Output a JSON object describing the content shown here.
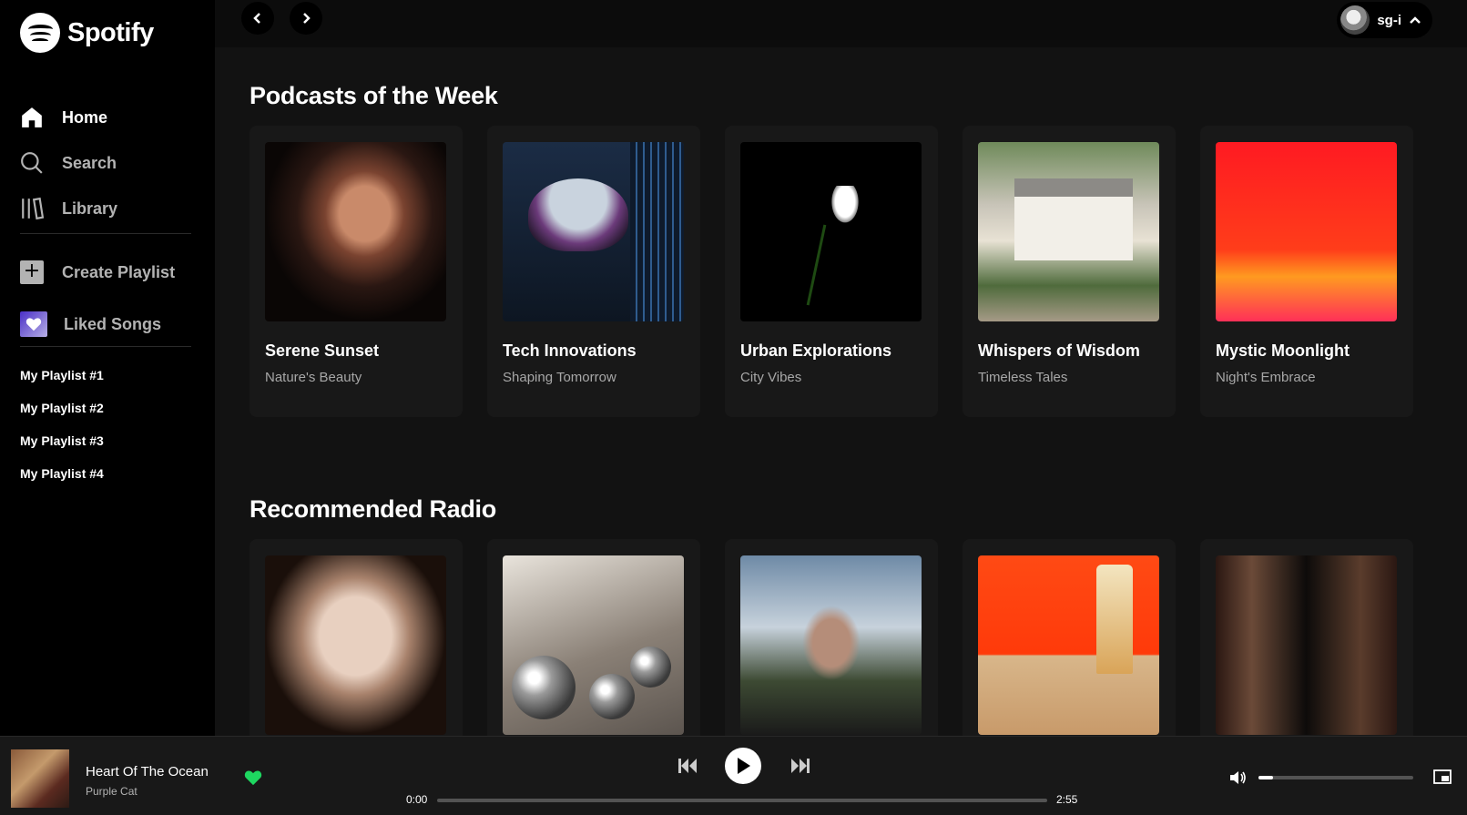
{
  "app": {
    "name": "Spotify"
  },
  "sidebar": {
    "nav": [
      {
        "label": "Home",
        "icon": "home-icon",
        "active": true
      },
      {
        "label": "Search",
        "icon": "search-icon",
        "active": false
      },
      {
        "label": "Library",
        "icon": "library-icon",
        "active": false
      }
    ],
    "create_playlist": "Create Playlist",
    "liked_songs": "Liked Songs",
    "playlists": [
      "My Playlist #1",
      "My Playlist #2",
      "My Playlist #3",
      "My Playlist #4"
    ]
  },
  "header": {
    "username": "sg-i"
  },
  "sections": [
    {
      "title": "Podcasts of the Week",
      "cards": [
        {
          "title": "Serene Sunset",
          "subtitle": "Nature's Beauty"
        },
        {
          "title": "Tech Innovations",
          "subtitle": "Shaping Tomorrow"
        },
        {
          "title": "Urban Explorations",
          "subtitle": "City Vibes"
        },
        {
          "title": "Whispers of Wisdom",
          "subtitle": "Timeless Tales"
        },
        {
          "title": "Mystic Moonlight",
          "subtitle": "Night's Embrace"
        }
      ]
    },
    {
      "title": "Recommended Radio",
      "cards": [
        {
          "title": "",
          "subtitle": ""
        },
        {
          "title": "",
          "subtitle": ""
        },
        {
          "title": "",
          "subtitle": ""
        },
        {
          "title": "",
          "subtitle": ""
        },
        {
          "title": "",
          "subtitle": ""
        }
      ]
    }
  ],
  "player": {
    "track": "Heart Of The Ocean",
    "artist": "Purple Cat",
    "current_time": "0:00",
    "duration": "2:55",
    "progress": 0,
    "volume": 0.1,
    "liked": true
  },
  "colors": {
    "accent": "#1ed760",
    "background": "#121212",
    "sidebar": "#000000",
    "card": "#181818"
  }
}
